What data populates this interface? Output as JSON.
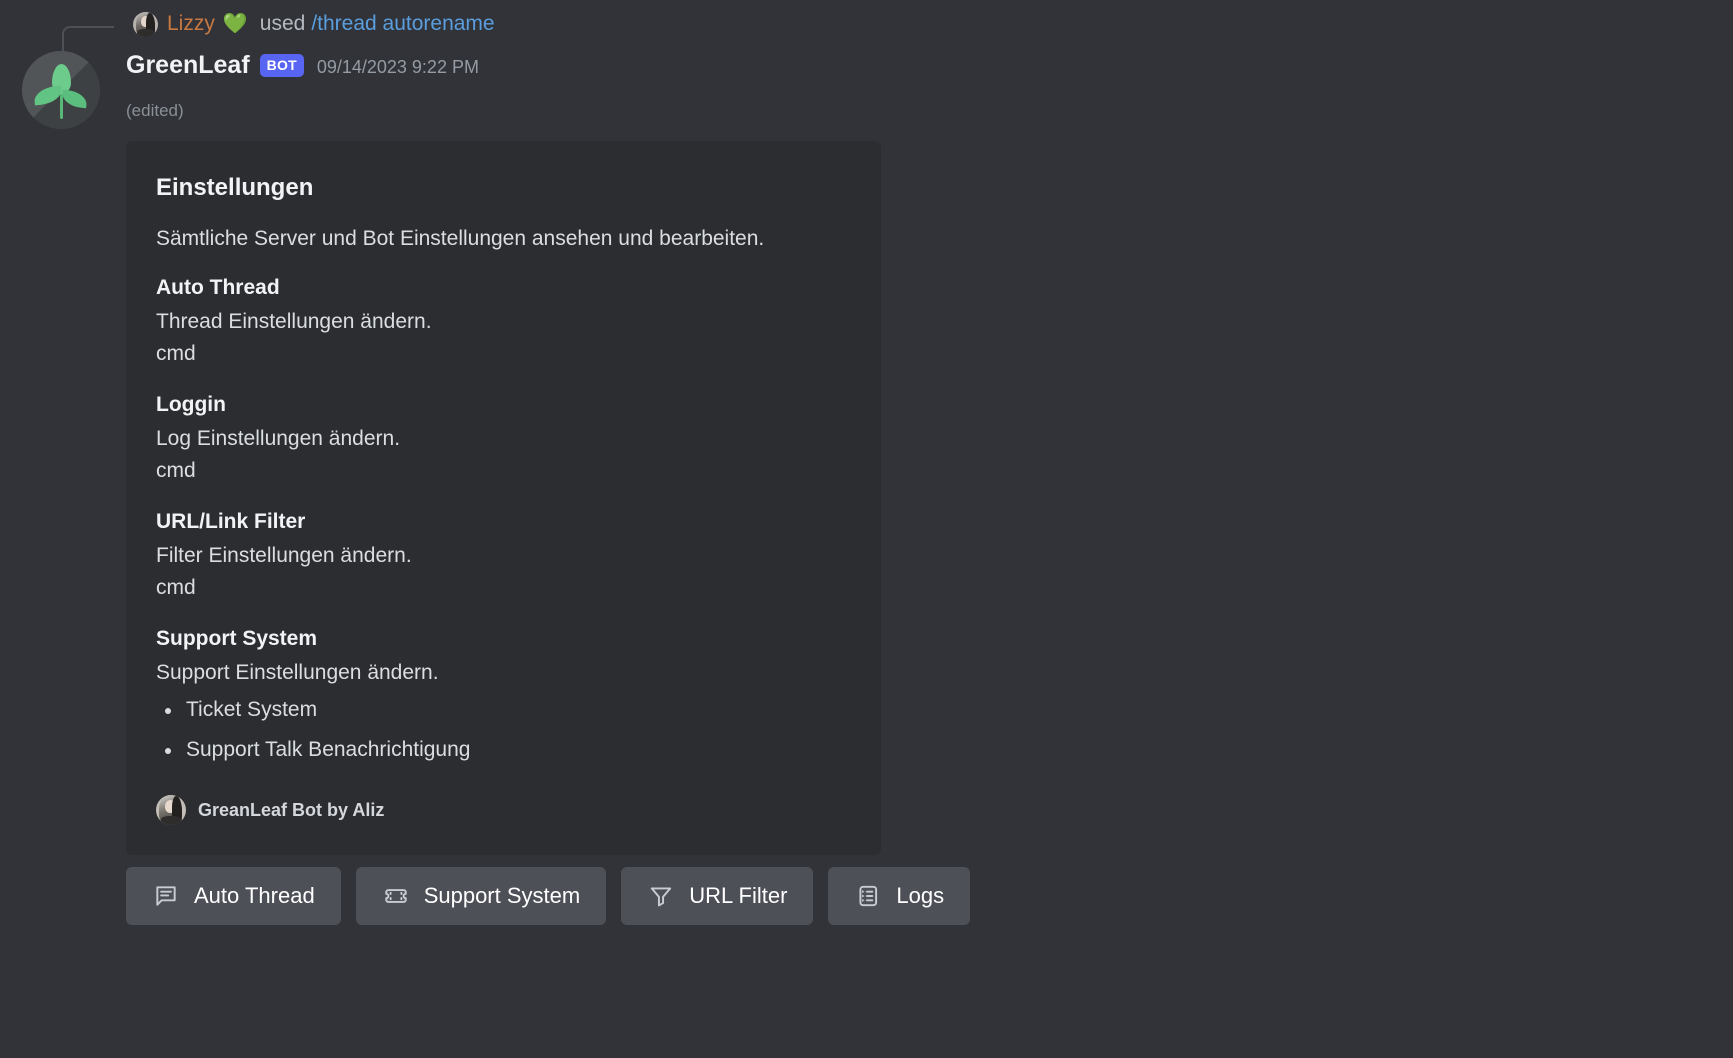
{
  "reply": {
    "username": "Lizzy",
    "emoji": "💚",
    "used_label": "used",
    "command": "/thread autorename"
  },
  "message": {
    "author": "GreenLeaf",
    "bot_badge": "BOT",
    "timestamp": "09/14/2023 9:22 PM",
    "edited_label": "(edited)"
  },
  "embed": {
    "title": "Einstellungen",
    "description": "Sämtliche Server und Bot Einstellungen ansehen und bearbeiten.",
    "fields": [
      {
        "name": "Auto Thread",
        "value": "Thread Einstellungen ändern.\ncmd"
      },
      {
        "name": "Loggin",
        "value": "Log Einstellungen ändern.\ncmd"
      },
      {
        "name": "URL/Link Filter",
        "value": "Filter Einstellungen ändern.\ncmd"
      },
      {
        "name": "Support System",
        "value": "Support Einstellungen ändern.",
        "list": [
          "Ticket System",
          "Support Talk Benachrichtigung"
        ]
      }
    ],
    "footer": "GreanLeaf Bot by Aliz"
  },
  "buttons": [
    {
      "label": "Auto Thread",
      "icon": "chat-bubble-lines-icon"
    },
    {
      "label": "Support System",
      "icon": "ticket-icon"
    },
    {
      "label": "URL Filter",
      "icon": "funnel-icon"
    },
    {
      "label": "Logs",
      "icon": "list-notepad-icon"
    }
  ],
  "colors": {
    "page_background": "#313338",
    "embed_background": "#2b2d31",
    "button_background": "#4e5058",
    "bot_badge": "#5865F2",
    "reply_username": "#C87941",
    "command_link": "#5A9EDE",
    "heart_green": "#3BA55D"
  }
}
